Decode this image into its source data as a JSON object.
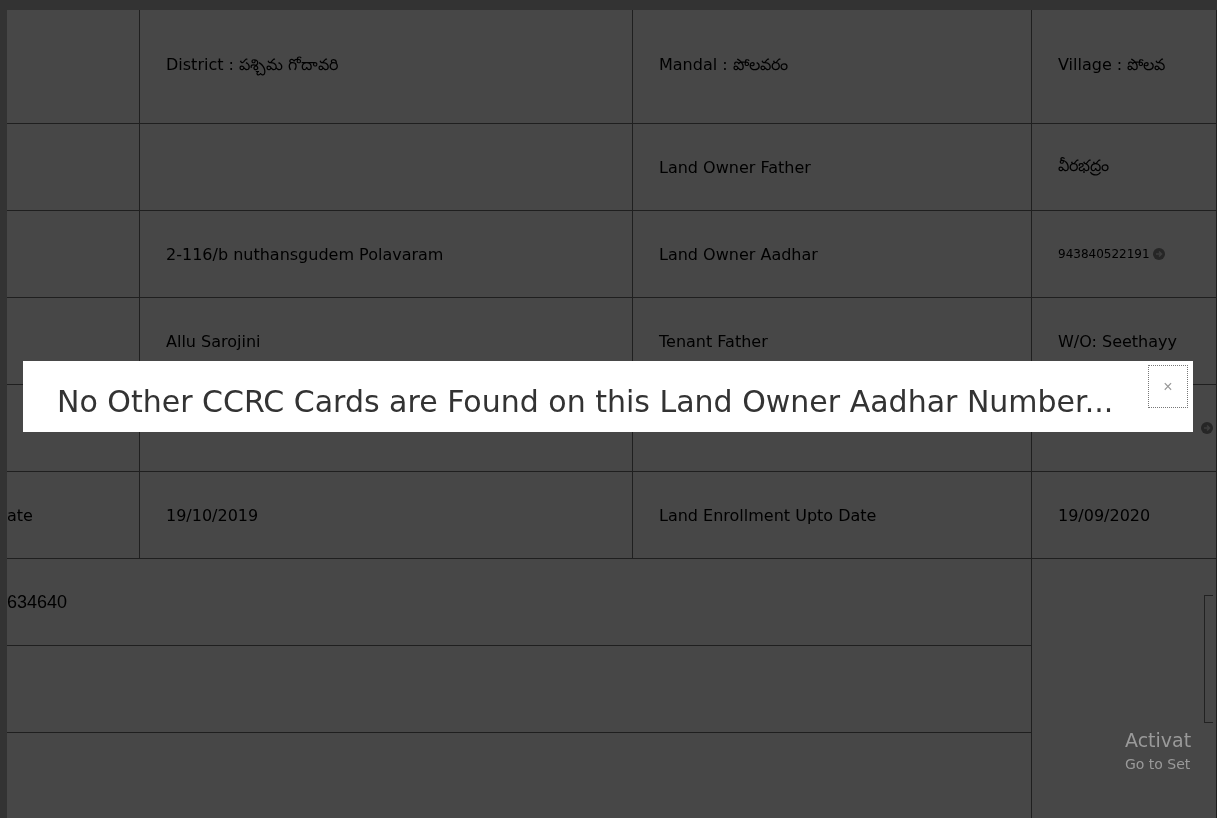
{
  "table": {
    "rows": [
      {
        "cells": [
          {},
          {
            "text": "District : పశ్చిమ గోదావరి"
          },
          {
            "text": "Mandal : పోలవరం"
          },
          {
            "text": "Village : పోలవ"
          }
        ]
      },
      {
        "cells": [
          {},
          {},
          {
            "text": "Land Owner Father"
          },
          {
            "text": "వీరభద్రం"
          }
        ]
      },
      {
        "cells": [
          {},
          {
            "text": "2-116/b nuthansgudem Polavaram"
          },
          {
            "text": "Land Owner Aadhar"
          },
          {
            "text": "943840522191",
            "link": true
          }
        ]
      },
      {
        "cells": [
          {},
          {
            "text": "Allu Sarojini"
          },
          {
            "text": "Tenant Father"
          },
          {
            "text": "W/O: Seethayy"
          }
        ]
      },
      {
        "cells": [
          {},
          {},
          {},
          {
            "link": true
          }
        ]
      },
      {
        "cells": [
          {
            "text": "ate"
          },
          {
            "text": "19/10/2019"
          },
          {
            "text": "Land Enrollment Upto Date"
          },
          {
            "text": "19/09/2020"
          }
        ]
      }
    ],
    "wide_rows": [
      {
        "text": "634640"
      },
      {},
      {}
    ],
    "side_panel": {
      "notice_title": "Activat",
      "notice_text": "Go to Set"
    }
  },
  "dialog": {
    "message": "No Other CCRC Cards are Found on this Land Owner Aadhar Number...",
    "close": "×"
  }
}
